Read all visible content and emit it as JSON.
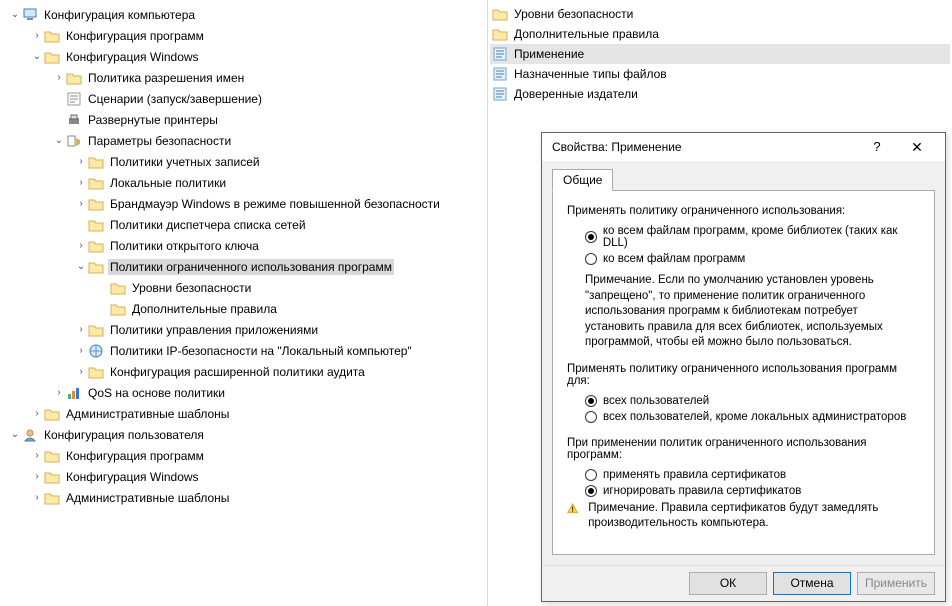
{
  "tree": [
    {
      "ind": 0,
      "chev": "open",
      "icon": "computer",
      "label": "Конфигурация компьютера",
      "sel": false
    },
    {
      "ind": 1,
      "chev": "closed",
      "icon": "folder",
      "label": "Конфигурация программ",
      "sel": false
    },
    {
      "ind": 1,
      "chev": "open",
      "icon": "folder",
      "label": "Конфигурация Windows",
      "sel": false
    },
    {
      "ind": 2,
      "chev": "closed",
      "icon": "folder",
      "label": "Политика разрешения имен",
      "sel": false
    },
    {
      "ind": 2,
      "chev": "",
      "icon": "script",
      "label": "Сценарии (запуск/завершение)",
      "sel": false
    },
    {
      "ind": 2,
      "chev": "",
      "icon": "printer",
      "label": "Развернутые принтеры",
      "sel": false
    },
    {
      "ind": 2,
      "chev": "open",
      "icon": "security",
      "label": "Параметры безопасности",
      "sel": false
    },
    {
      "ind": 3,
      "chev": "closed",
      "icon": "folder",
      "label": "Политики учетных записей",
      "sel": false
    },
    {
      "ind": 3,
      "chev": "closed",
      "icon": "folder",
      "label": "Локальные политики",
      "sel": false
    },
    {
      "ind": 3,
      "chev": "closed",
      "icon": "folder",
      "label": "Брандмауэр Windows в режиме повышенной безопасности",
      "sel": false
    },
    {
      "ind": 3,
      "chev": "",
      "icon": "folder",
      "label": "Политики диспетчера списка сетей",
      "sel": false
    },
    {
      "ind": 3,
      "chev": "closed",
      "icon": "folder",
      "label": "Политики открытого ключа",
      "sel": false
    },
    {
      "ind": 3,
      "chev": "open",
      "icon": "folder",
      "label": "Политики ограниченного использования программ",
      "sel": true
    },
    {
      "ind": 4,
      "chev": "",
      "icon": "folder",
      "label": "Уровни безопасности",
      "sel": false
    },
    {
      "ind": 4,
      "chev": "",
      "icon": "folder",
      "label": "Дополнительные правила",
      "sel": false
    },
    {
      "ind": 3,
      "chev": "closed",
      "icon": "folder",
      "label": "Политики управления приложениями",
      "sel": false
    },
    {
      "ind": 3,
      "chev": "closed",
      "icon": "ipsec",
      "label": "Политики IP-безопасности на \"Локальный компьютер\"",
      "sel": false
    },
    {
      "ind": 3,
      "chev": "closed",
      "icon": "folder",
      "label": "Конфигурация расширенной политики аудита",
      "sel": false
    },
    {
      "ind": 2,
      "chev": "closed",
      "icon": "qos",
      "label": "QoS на основе политики",
      "sel": false
    },
    {
      "ind": 1,
      "chev": "closed",
      "icon": "folder",
      "label": "Административные шаблоны",
      "sel": false
    },
    {
      "ind": 0,
      "chev": "open",
      "icon": "user",
      "label": "Конфигурация пользователя",
      "sel": false
    },
    {
      "ind": 1,
      "chev": "closed",
      "icon": "folder",
      "label": "Конфигурация программ",
      "sel": false
    },
    {
      "ind": 1,
      "chev": "closed",
      "icon": "folder",
      "label": "Конфигурация Windows",
      "sel": false
    },
    {
      "ind": 1,
      "chev": "closed",
      "icon": "folder",
      "label": "Административные шаблоны",
      "sel": false
    }
  ],
  "list": [
    {
      "icon": "folder",
      "label": "Уровни безопасности",
      "sel": false
    },
    {
      "icon": "folder",
      "label": "Дополнительные правила",
      "sel": false
    },
    {
      "icon": "item-a",
      "label": "Применение",
      "sel": true
    },
    {
      "icon": "item-b",
      "label": "Назначенные типы файлов",
      "sel": false
    },
    {
      "icon": "item-c",
      "label": "Доверенные издатели",
      "sel": false
    }
  ],
  "dialog": {
    "title": "Свойства: Применение",
    "help": "?",
    "close": "✕",
    "tab1": "Общие",
    "grp1": {
      "title": "Применять политику ограниченного использования:",
      "opt1": "ко всем файлам программ, кроме библиотек (таких как DLL)",
      "opt2": "ко всем файлам программ",
      "note": "Примечание. Если по умолчанию установлен уровень \"запрещено\", то применение политик ограниченного использования программ к библиотекам потребует установить правила для всех библиотек, используемых  программой, чтобы ей можно было пользоваться."
    },
    "grp2": {
      "title": "Применять политику ограниченного использования программ для:",
      "opt1": "всех пользователей",
      "opt2": "всех пользователей, кроме локальных администраторов"
    },
    "grp3": {
      "title": "При применении политик ограниченного использования программ:",
      "opt1": "применять правила сертификатов",
      "opt2": "игнорировать правила сертификатов",
      "warn": "Примечание. Правила сертификатов будут замедлять производительность компьютера."
    },
    "btn_ok": "ОК",
    "btn_cancel": "Отмена",
    "btn_apply": "Применить"
  }
}
